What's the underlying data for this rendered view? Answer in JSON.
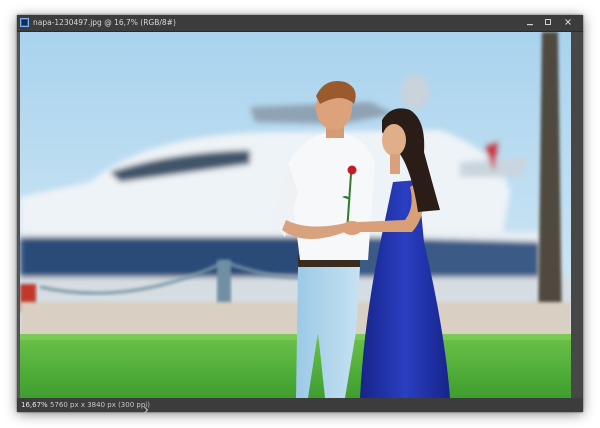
{
  "window": {
    "title": "napa-1230497.jpg @ 16,7% (RGB/8#)",
    "controls": [
      "minimize",
      "maximize",
      "close"
    ]
  },
  "status": {
    "zoom": "16,67%",
    "dimensions": "5760 px x 3840 px (300 ppi)"
  },
  "icons": {
    "document": "photoshop-document-icon",
    "status_more": "chevron-right-icon"
  },
  "colors": {
    "frame": "#535353",
    "titlebar": "#3c3c3c",
    "sky": "#bcdcef",
    "grass": "#4fb23a",
    "dress": "#1e2fa0"
  }
}
